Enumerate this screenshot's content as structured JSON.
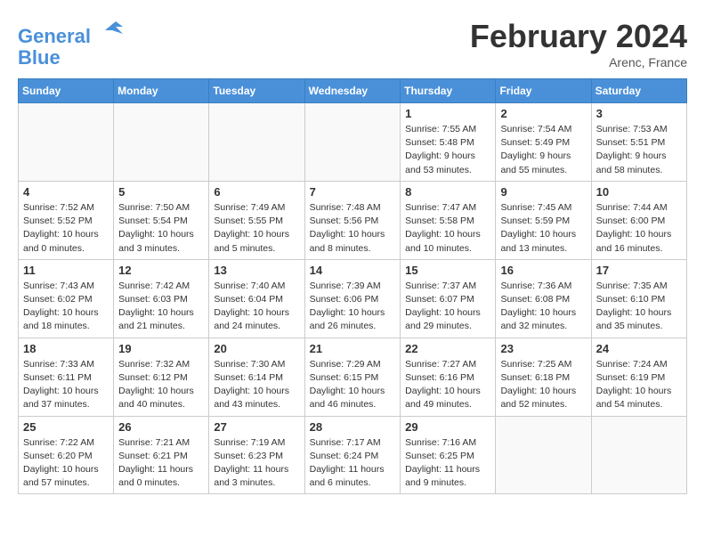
{
  "header": {
    "logo_line1": "General",
    "logo_line2": "Blue",
    "month_title": "February 2024",
    "location": "Arenc, France"
  },
  "weekdays": [
    "Sunday",
    "Monday",
    "Tuesday",
    "Wednesday",
    "Thursday",
    "Friday",
    "Saturday"
  ],
  "weeks": [
    [
      {
        "day": "",
        "info": ""
      },
      {
        "day": "",
        "info": ""
      },
      {
        "day": "",
        "info": ""
      },
      {
        "day": "",
        "info": ""
      },
      {
        "day": "1",
        "info": "Sunrise: 7:55 AM\nSunset: 5:48 PM\nDaylight: 9 hours\nand 53 minutes."
      },
      {
        "day": "2",
        "info": "Sunrise: 7:54 AM\nSunset: 5:49 PM\nDaylight: 9 hours\nand 55 minutes."
      },
      {
        "day": "3",
        "info": "Sunrise: 7:53 AM\nSunset: 5:51 PM\nDaylight: 9 hours\nand 58 minutes."
      }
    ],
    [
      {
        "day": "4",
        "info": "Sunrise: 7:52 AM\nSunset: 5:52 PM\nDaylight: 10 hours\nand 0 minutes."
      },
      {
        "day": "5",
        "info": "Sunrise: 7:50 AM\nSunset: 5:54 PM\nDaylight: 10 hours\nand 3 minutes."
      },
      {
        "day": "6",
        "info": "Sunrise: 7:49 AM\nSunset: 5:55 PM\nDaylight: 10 hours\nand 5 minutes."
      },
      {
        "day": "7",
        "info": "Sunrise: 7:48 AM\nSunset: 5:56 PM\nDaylight: 10 hours\nand 8 minutes."
      },
      {
        "day": "8",
        "info": "Sunrise: 7:47 AM\nSunset: 5:58 PM\nDaylight: 10 hours\nand 10 minutes."
      },
      {
        "day": "9",
        "info": "Sunrise: 7:45 AM\nSunset: 5:59 PM\nDaylight: 10 hours\nand 13 minutes."
      },
      {
        "day": "10",
        "info": "Sunrise: 7:44 AM\nSunset: 6:00 PM\nDaylight: 10 hours\nand 16 minutes."
      }
    ],
    [
      {
        "day": "11",
        "info": "Sunrise: 7:43 AM\nSunset: 6:02 PM\nDaylight: 10 hours\nand 18 minutes."
      },
      {
        "day": "12",
        "info": "Sunrise: 7:42 AM\nSunset: 6:03 PM\nDaylight: 10 hours\nand 21 minutes."
      },
      {
        "day": "13",
        "info": "Sunrise: 7:40 AM\nSunset: 6:04 PM\nDaylight: 10 hours\nand 24 minutes."
      },
      {
        "day": "14",
        "info": "Sunrise: 7:39 AM\nSunset: 6:06 PM\nDaylight: 10 hours\nand 26 minutes."
      },
      {
        "day": "15",
        "info": "Sunrise: 7:37 AM\nSunset: 6:07 PM\nDaylight: 10 hours\nand 29 minutes."
      },
      {
        "day": "16",
        "info": "Sunrise: 7:36 AM\nSunset: 6:08 PM\nDaylight: 10 hours\nand 32 minutes."
      },
      {
        "day": "17",
        "info": "Sunrise: 7:35 AM\nSunset: 6:10 PM\nDaylight: 10 hours\nand 35 minutes."
      }
    ],
    [
      {
        "day": "18",
        "info": "Sunrise: 7:33 AM\nSunset: 6:11 PM\nDaylight: 10 hours\nand 37 minutes."
      },
      {
        "day": "19",
        "info": "Sunrise: 7:32 AM\nSunset: 6:12 PM\nDaylight: 10 hours\nand 40 minutes."
      },
      {
        "day": "20",
        "info": "Sunrise: 7:30 AM\nSunset: 6:14 PM\nDaylight: 10 hours\nand 43 minutes."
      },
      {
        "day": "21",
        "info": "Sunrise: 7:29 AM\nSunset: 6:15 PM\nDaylight: 10 hours\nand 46 minutes."
      },
      {
        "day": "22",
        "info": "Sunrise: 7:27 AM\nSunset: 6:16 PM\nDaylight: 10 hours\nand 49 minutes."
      },
      {
        "day": "23",
        "info": "Sunrise: 7:25 AM\nSunset: 6:18 PM\nDaylight: 10 hours\nand 52 minutes."
      },
      {
        "day": "24",
        "info": "Sunrise: 7:24 AM\nSunset: 6:19 PM\nDaylight: 10 hours\nand 54 minutes."
      }
    ],
    [
      {
        "day": "25",
        "info": "Sunrise: 7:22 AM\nSunset: 6:20 PM\nDaylight: 10 hours\nand 57 minutes."
      },
      {
        "day": "26",
        "info": "Sunrise: 7:21 AM\nSunset: 6:21 PM\nDaylight: 11 hours\nand 0 minutes."
      },
      {
        "day": "27",
        "info": "Sunrise: 7:19 AM\nSunset: 6:23 PM\nDaylight: 11 hours\nand 3 minutes."
      },
      {
        "day": "28",
        "info": "Sunrise: 7:17 AM\nSunset: 6:24 PM\nDaylight: 11 hours\nand 6 minutes."
      },
      {
        "day": "29",
        "info": "Sunrise: 7:16 AM\nSunset: 6:25 PM\nDaylight: 11 hours\nand 9 minutes."
      },
      {
        "day": "",
        "info": ""
      },
      {
        "day": "",
        "info": ""
      }
    ]
  ]
}
